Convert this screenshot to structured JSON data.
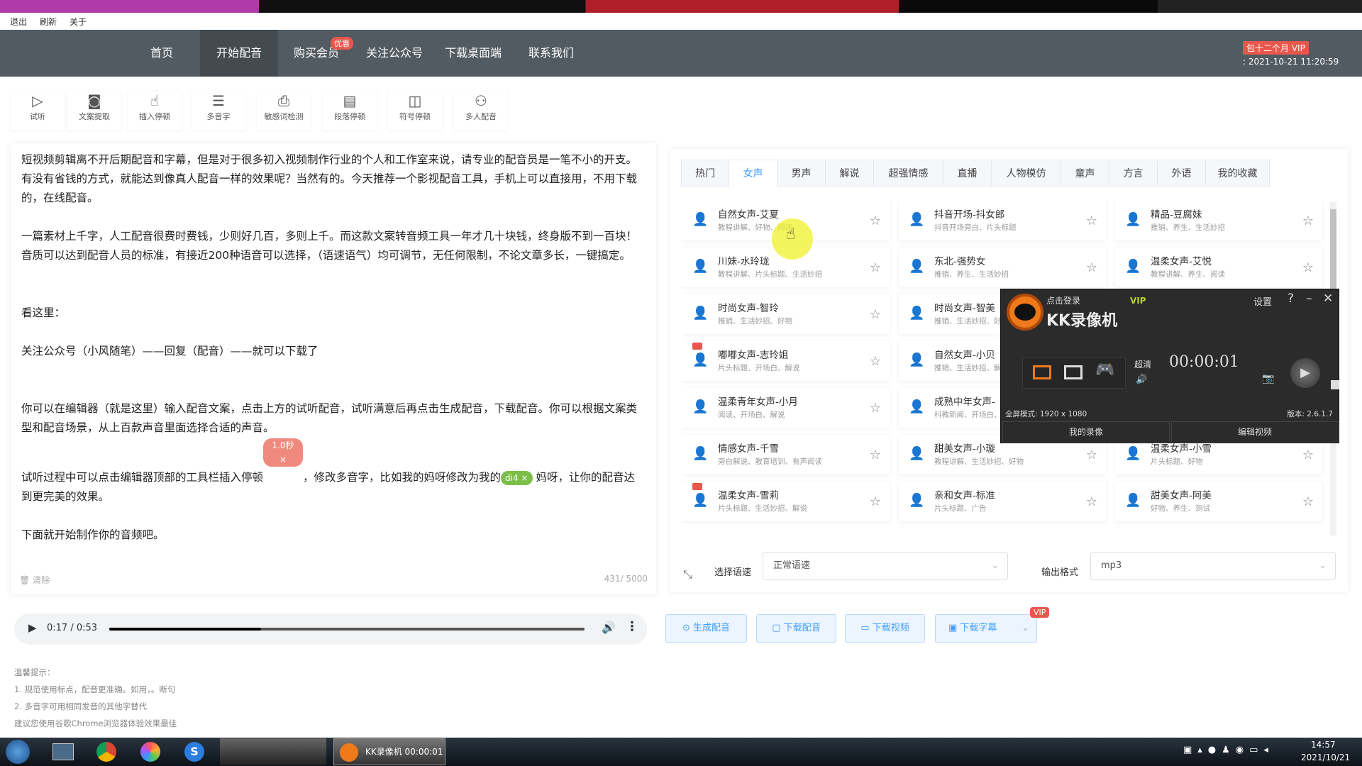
{
  "menubar": {
    "items": [
      "退出",
      "刷新",
      "关于"
    ]
  },
  "nav": {
    "items": [
      "首页",
      "开始配音",
      "购买会员",
      "关注公众号",
      "下载桌面端",
      "联系我们"
    ],
    "active": "开始配音",
    "promo_badge": "优惠",
    "vip_badge": "包十二个月 VIP",
    "vip_expiry": ": 2021-10-21 11:20:59"
  },
  "toolbar": [
    {
      "label": "试听",
      "icon": "play-circle-icon",
      "glyph": "▷"
    },
    {
      "label": "文案提取",
      "icon": "camera-icon",
      "glyph": "◙"
    },
    {
      "label": "插入停顿",
      "icon": "hand-pointer-icon",
      "glyph": "☝"
    },
    {
      "label": "多音字",
      "icon": "sliders-icon",
      "glyph": "☰"
    },
    {
      "label": "敏感词检测",
      "icon": "printer-icon",
      "glyph": "⎙"
    },
    {
      "label": "段落停顿",
      "icon": "document-icon",
      "glyph": "▤"
    },
    {
      "label": "符号停顿",
      "icon": "pause-box-icon",
      "glyph": "◫"
    },
    {
      "label": "多人配音",
      "icon": "users-icon",
      "glyph": "⚇"
    }
  ],
  "editor": {
    "paragraphs": [
      "短视频剪辑离不开后期配音和字幕，但是对于很多初入视频制作行业的个人和工作室来说，请专业的配音员是一笔不小的开支。有没有省钱的方式，就能达到像真人配音一样的效果呢？当然有的。今天推荐一个影视配音工具，手机上可以直接用，不用下载的，在线配音。",
      "",
      "一篇素材上千字，人工配音很费时费钱，少则好几百，多则上千。而这款文案转音频工具一年才几十块钱，终身版不到一百块！音质可以达到配音人员的标准，有接近200种语音可以选择，（语速语气）均可调节，无任何限制，不论文章多长，一键搞定。",
      "",
      "",
      "看这里：",
      "",
      "关注公众号（小风随笔）——回复（配音）——就可以下载了",
      "",
      "",
      "你可以在编辑器（就是这里）输入配音文案，点击上方的试听配音，试听满意后再点击生成配音，下载配音。你可以根据文案类型和配音场景，从上百款声音里面选择合适的声音。",
      ""
    ],
    "p7_a": "试听过程中可以点击编辑器顶部的工具栏插入停顿",
    "pause_tag": "1.0秒 ×",
    "p7_b": "，修改多音字，比如我的妈呀修改为我的",
    "pinyin_tag": "di4 ×",
    "p7_c": "妈呀，让你的配音达到更完美的效果。",
    "p8": "下面就开始制作你的音频吧。",
    "clear_label": "清除",
    "char_count": "431/ 5000"
  },
  "player": {
    "time": "0:17 / 0:53",
    "progress": 0.32
  },
  "tips": [
    "温馨提示：",
    "1. 规范使用标点，配音更准确。如用，。断句",
    "2. 多音字可用相同发音的其他字替代",
    "建议您使用谷歌Chrome浏览器体验效果最佳"
  ],
  "voice_tabs": [
    "热门",
    "女声",
    "男声",
    "解说",
    "超强情感",
    "直播",
    "人物模仿",
    "童声",
    "方言",
    "外语",
    "我的收藏"
  ],
  "voice_tab_active": "女声",
  "voices": [
    {
      "name": "自然女声-艾夏",
      "desc": "教程讲解、好物、阅读"
    },
    {
      "name": "抖音开场-抖女郎",
      "desc": "抖音开场旁白、片头标题"
    },
    {
      "name": "精品-豆腐妹",
      "desc": "推销、养生、生活妙招"
    },
    {
      "name": "川妹-水玲珑",
      "desc": "教程讲解、片头标题、生活妙招"
    },
    {
      "name": "东北-强势女",
      "desc": "推销、养生、生活妙招"
    },
    {
      "name": "温柔女声-艾悦",
      "desc": "教程讲解、养生、阅读"
    },
    {
      "name": "时尚女声-智玲",
      "desc": "推销、生活妙招、好物"
    },
    {
      "name": "时尚女声-智美",
      "desc": "推销、生活妙招、好物"
    },
    {
      "name": "",
      "desc": ""
    },
    {
      "name": "嘟嘟女声-志玲姐",
      "desc": "片头标题、开场白、解说",
      "hot": true
    },
    {
      "name": "自然女声-小贝",
      "desc": "推销、生活妙招、解说"
    },
    {
      "name": "",
      "desc": ""
    },
    {
      "name": "温柔青年女声-小月",
      "desc": "阅读、开场白、解说"
    },
    {
      "name": "成熟中年女声-",
      "desc": "科教新闻、开场白、"
    },
    {
      "name": "",
      "desc": ""
    },
    {
      "name": "情感女声-千雪",
      "desc": "旁白解说、教育培训、有声阅读"
    },
    {
      "name": "甜美女声-小璇",
      "desc": "教程讲解、生活妙招、好物"
    },
    {
      "name": "温柔女声-小雪",
      "desc": "片头标题、好物"
    },
    {
      "name": "温柔女声-雪莉",
      "desc": "片头标题、生活妙招、解说",
      "hot": true
    },
    {
      "name": "亲和女声-标准",
      "desc": "片头标题、广告"
    },
    {
      "name": "甜美女声-阿美",
      "desc": "好物、养生、测试"
    }
  ],
  "settings": {
    "speed_label": "选择语速",
    "speed_value": "正常语速",
    "format_label": "输出格式",
    "format_value": "mp3"
  },
  "actions": {
    "generate": "⊙ 生成配音",
    "download_audio": "▢ 下载配音",
    "download_video": "▭ 下载视频",
    "download_subtitle": "▣ 下载字幕",
    "vip": "VIP"
  },
  "kk": {
    "login": "点击登录",
    "vip": "VIP",
    "title": "KK录像机",
    "settings": "设置",
    "help": "?",
    "minimize": "–",
    "close": "✕",
    "quality": "超清",
    "timer": "00:00:01",
    "mode": "全屏模式: 1920 x 1080",
    "version": "版本: 2.6.1.7",
    "my_recordings": "我的录像",
    "edit_video": "编辑视频"
  },
  "taskbar": {
    "kk_task": "KK录像机 00:00:01",
    "time": "14:57",
    "date": "2021/10/21"
  },
  "colors": {
    "nav_bg": "#525b62",
    "accent": "#409eff",
    "badge": "#e8574c",
    "kk_orange": "#f07a1a"
  }
}
